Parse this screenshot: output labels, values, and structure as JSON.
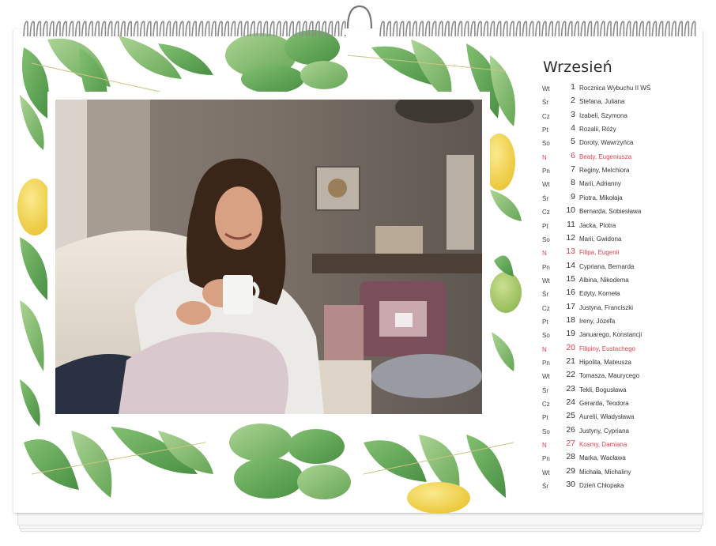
{
  "calendar": {
    "month": "Wrzesień",
    "days": [
      {
        "dow": "Wt",
        "num": "1",
        "names": "Rocznica Wybuchu II WŚ",
        "sunday": false
      },
      {
        "dow": "Śr",
        "num": "2",
        "names": "Stefana, Juliana",
        "sunday": false
      },
      {
        "dow": "Cz",
        "num": "3",
        "names": "Izabeli, Szymona",
        "sunday": false
      },
      {
        "dow": "Pt",
        "num": "4",
        "names": "Rozalii, Róży",
        "sunday": false
      },
      {
        "dow": "So",
        "num": "5",
        "names": "Doroty, Wawrzyńca",
        "sunday": false
      },
      {
        "dow": "N",
        "num": "6",
        "names": "Beaty, Eugeniusza",
        "sunday": true
      },
      {
        "dow": "Pn",
        "num": "7",
        "names": "Reginy, Melchiora",
        "sunday": false
      },
      {
        "dow": "Wt",
        "num": "8",
        "names": "Marii, Adrianny",
        "sunday": false
      },
      {
        "dow": "Śr",
        "num": "9",
        "names": "Piotra, Mikołaja",
        "sunday": false
      },
      {
        "dow": "Cz",
        "num": "10",
        "names": "Bernarda, Sobiesława",
        "sunday": false
      },
      {
        "dow": "Pt",
        "num": "11",
        "names": "Jacka, Piotra",
        "sunday": false
      },
      {
        "dow": "So",
        "num": "12",
        "names": "Marii, Gwidona",
        "sunday": false
      },
      {
        "dow": "N",
        "num": "13",
        "names": "Filipa, Eugenii",
        "sunday": true
      },
      {
        "dow": "Pn",
        "num": "14",
        "names": "Cypriana, Bernarda",
        "sunday": false
      },
      {
        "dow": "Wt",
        "num": "15",
        "names": "Albina, Nikodema",
        "sunday": false
      },
      {
        "dow": "Śr",
        "num": "16",
        "names": "Edyty, Korneła",
        "sunday": false
      },
      {
        "dow": "Cz",
        "num": "17",
        "names": "Justyna, Franciszki",
        "sunday": false
      },
      {
        "dow": "Pt",
        "num": "18",
        "names": "Ireny, Józefa",
        "sunday": false
      },
      {
        "dow": "So",
        "num": "19",
        "names": "Januarego, Konstancji",
        "sunday": false
      },
      {
        "dow": "N",
        "num": "20",
        "names": "Filipiny, Eustachego",
        "sunday": true
      },
      {
        "dow": "Pn",
        "num": "21",
        "names": "Hipolita, Mateusza",
        "sunday": false
      },
      {
        "dow": "Wt",
        "num": "22",
        "names": "Tomasza, Maurycego",
        "sunday": false
      },
      {
        "dow": "Śr",
        "num": "23",
        "names": "Tekli, Bogusława",
        "sunday": false
      },
      {
        "dow": "Cz",
        "num": "24",
        "names": "Gerarda, Teodora",
        "sunday": false
      },
      {
        "dow": "Pt",
        "num": "25",
        "names": "Aurelii, Władysława",
        "sunday": false
      },
      {
        "dow": "So",
        "num": "26",
        "names": "Justyny, Cypriana",
        "sunday": false
      },
      {
        "dow": "N",
        "num": "27",
        "names": "Kosmy, Damiana",
        "sunday": true
      },
      {
        "dow": "Pn",
        "num": "28",
        "names": "Marka, Wacława",
        "sunday": false
      },
      {
        "dow": "Wt",
        "num": "29",
        "names": "Michała, Michaliny",
        "sunday": false
      },
      {
        "dow": "Śr",
        "num": "30",
        "names": "Dzień Chłopaka",
        "sunday": false
      }
    ]
  },
  "colors": {
    "sunday": "#e2424f",
    "leaf": "#4e9a45",
    "lemon": "#f0d23a"
  },
  "icons": {
    "binding": "spiral-binding-icon",
    "hanger": "wall-hanger-icon"
  }
}
